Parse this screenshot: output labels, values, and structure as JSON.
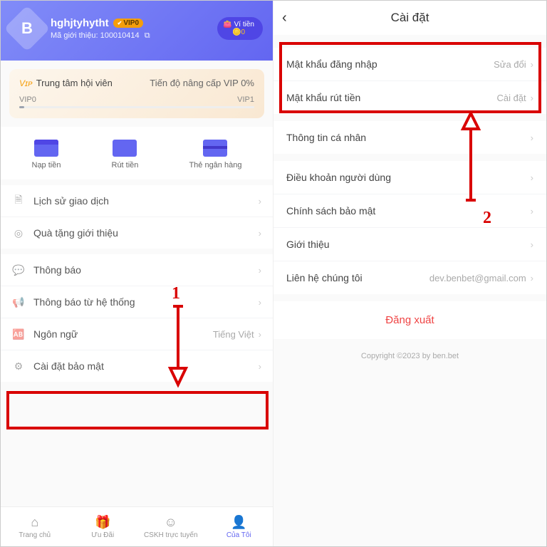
{
  "profile": {
    "name": "hghjtyhytht",
    "vip_badge": "VIP0",
    "referral_label": "Mã giới thiệu: 100010414",
    "wallet_label": "Ví tiền",
    "wallet_balance": "0"
  },
  "vip_card": {
    "title": "Trung tâm hội viên",
    "progress": "Tiến độ nâng cấp VIP 0%",
    "from": "VIP0",
    "to": "VIP1"
  },
  "actions": {
    "deposit": "Nạp tiền",
    "withdraw": "Rút tiền",
    "card": "Thẻ ngân hàng"
  },
  "list1": {
    "history": "Lịch sử giao dịch",
    "gift": "Quà tặng giới thiệu"
  },
  "list2": {
    "notice": "Thông báo",
    "sysnotice": "Thông báo từ hệ thống",
    "language_label": "Ngôn ngữ",
    "language_value": "Tiếng Việt",
    "security": "Cài đặt bảo mật"
  },
  "tabs": {
    "home": "Trang chủ",
    "promo": "Ưu Đãi",
    "support": "CSKH trực tuyến",
    "mine": "Của Tôi"
  },
  "right": {
    "title": "Cài đặt",
    "pw_login_label": "Mật khẩu đăng nhập",
    "pw_login_value": "Sửa đổi",
    "pw_withdraw_label": "Mật khẩu rút tiền",
    "pw_withdraw_value": "Cài đặt",
    "personal": "Thông tin cá nhân",
    "terms": "Điều khoản người dùng",
    "privacy": "Chính sách bảo mật",
    "about": "Giới thiệu",
    "contact_label": "Liên hệ chúng tôi",
    "contact_value": "dev.benbet@gmail.com",
    "logout": "Đăng xuất",
    "copyright": "Copyright ©2023 by ben.bet"
  },
  "annotations": {
    "num1": "1",
    "num2": "2"
  }
}
